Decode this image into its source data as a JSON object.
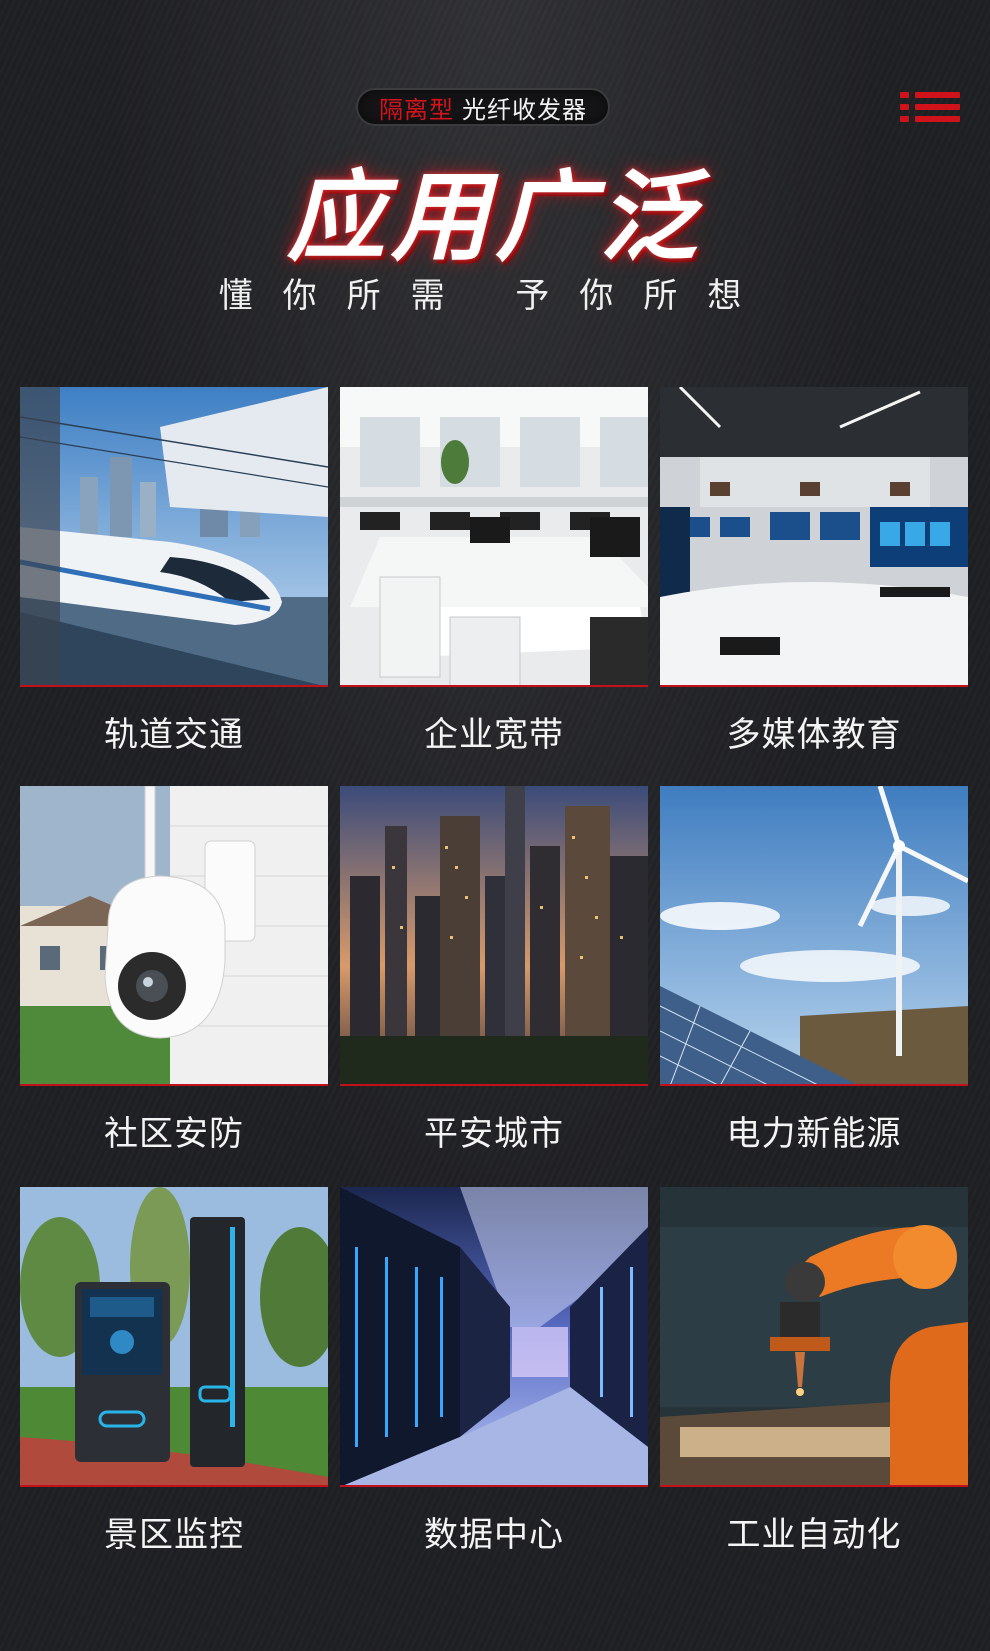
{
  "header": {
    "badge_tag": "隔离型",
    "badge_name": "光纤收发器",
    "title": "应用广泛",
    "subtitle": "懂你所需 予你所想"
  },
  "colors": {
    "accent": "#d0121a",
    "background": "#1f2023"
  },
  "icons": {
    "menu": "list-menu-icon"
  },
  "applications": [
    {
      "label": "轨道交通",
      "image": "high-speed-train-photo"
    },
    {
      "label": "企业宽带",
      "image": "office-workspace-photo"
    },
    {
      "label": "多媒体教育",
      "image": "multimedia-classroom-photo"
    },
    {
      "label": "社区安防",
      "image": "security-camera-photo"
    },
    {
      "label": "平安城市",
      "image": "city-skyline-photo"
    },
    {
      "label": "电力新能源",
      "image": "wind-solar-power-photo"
    },
    {
      "label": "景区监控",
      "image": "scenic-kiosk-photo"
    },
    {
      "label": "数据中心",
      "image": "server-room-photo"
    },
    {
      "label": "工业自动化",
      "image": "industrial-robot-arm-photo"
    }
  ]
}
